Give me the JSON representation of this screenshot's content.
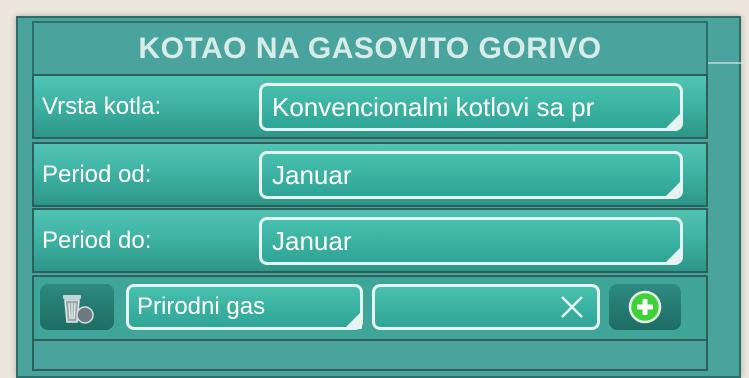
{
  "dialog": {
    "title": "KOTAO NA GASOVITO GORIVO"
  },
  "fields": [
    {
      "label": "Vrsta kotla:",
      "value": "Konvencionalni kotlovi sa pr"
    },
    {
      "label": "Period od:",
      "value": "Januar"
    },
    {
      "label": "Period do:",
      "value": "Januar"
    }
  ],
  "fuel_row": {
    "delete_icon": "trash-bin-icon",
    "fuel_value": "Prirodni gas",
    "amount_value": "",
    "clear_icon": "close-icon",
    "add_icon": "plus-circle-icon"
  },
  "colors": {
    "panel": "#4aa39d",
    "title_text": "#d7ece9",
    "field_border": "#e6f4f1",
    "add_green": "#35c43a"
  }
}
